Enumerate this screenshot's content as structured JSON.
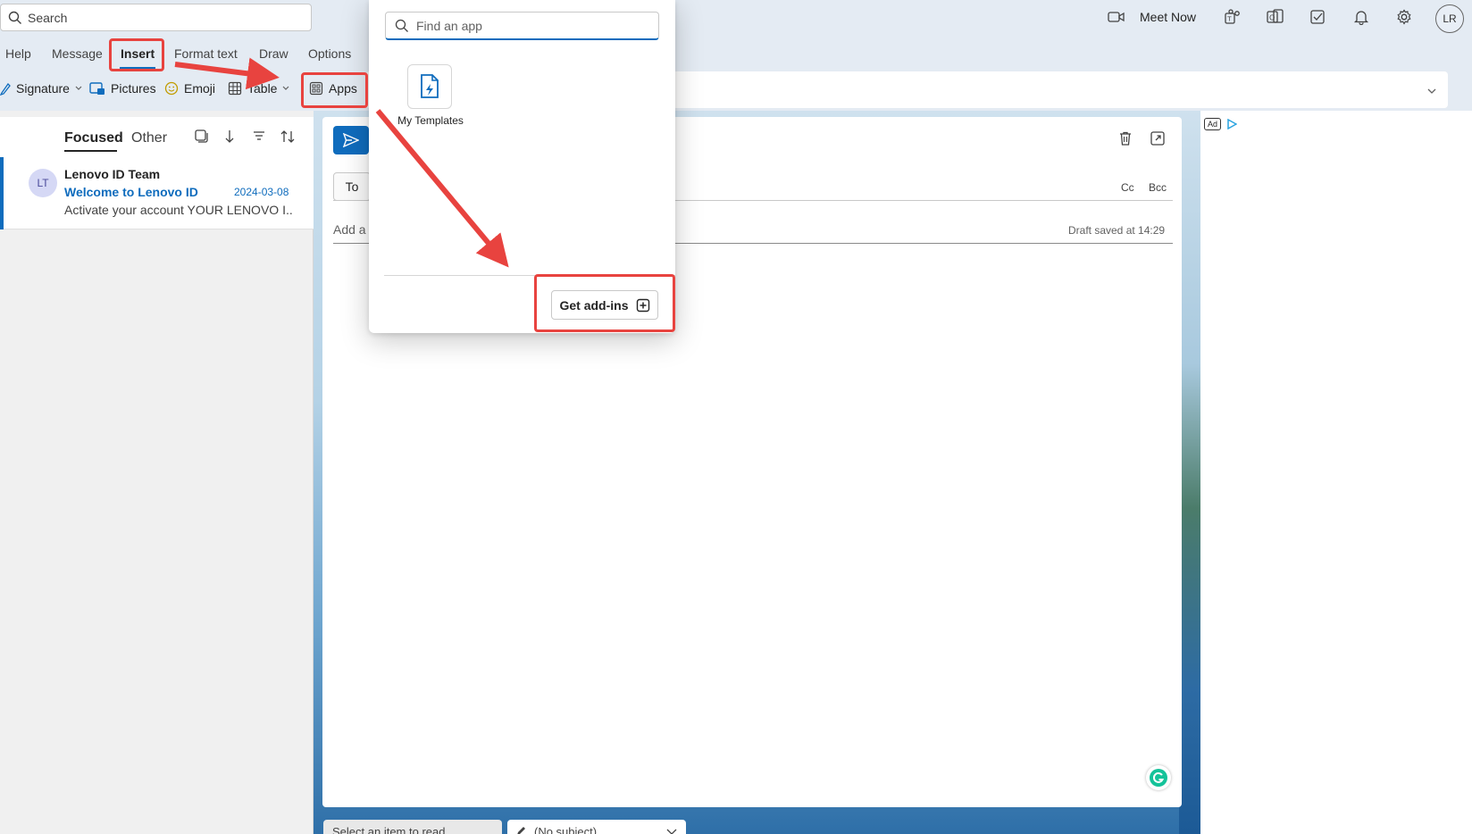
{
  "header": {
    "search_placeholder": "Search",
    "meet_now_label": "Meet Now",
    "user_initials": "LR",
    "icons": [
      "video-icon",
      "teams-icon",
      "office-icon",
      "todo-icon",
      "bell-icon",
      "gear-icon"
    ]
  },
  "ribbon": {
    "tabs": [
      "Help",
      "Message",
      "Insert",
      "Format text",
      "Draw",
      "Options"
    ],
    "active_tab": "Insert",
    "tools": {
      "signature": "Signature",
      "pictures": "Pictures",
      "emoji": "Emoji",
      "table": "Table",
      "apps": "Apps"
    }
  },
  "mail_list": {
    "tab_focused": "Focused",
    "tab_other": "Other",
    "items": [
      {
        "initials": "LT",
        "sender": "Lenovo ID Team",
        "subject": "Welcome to Lenovo ID",
        "date": "2024-03-08",
        "preview": "Activate your account YOUR LENOVO I..."
      }
    ]
  },
  "compose": {
    "to_label": "To",
    "cc_label": "Cc",
    "bcc_label": "Bcc",
    "subject_placeholder": "Add a",
    "draft_status": "Draft saved at 14:29"
  },
  "apps_popup": {
    "find_placeholder": "Find an app",
    "apps": [
      {
        "name": "My Templates"
      }
    ],
    "get_addins_label": "Get add-ins"
  },
  "bottom_tabs": {
    "read_tab": "Select an item to read",
    "draft_tab": "(No subject)"
  },
  "ad": {
    "label": "Ad"
  },
  "colors": {
    "accent": "#0f6cbd",
    "annotation": "#e8433f"
  }
}
